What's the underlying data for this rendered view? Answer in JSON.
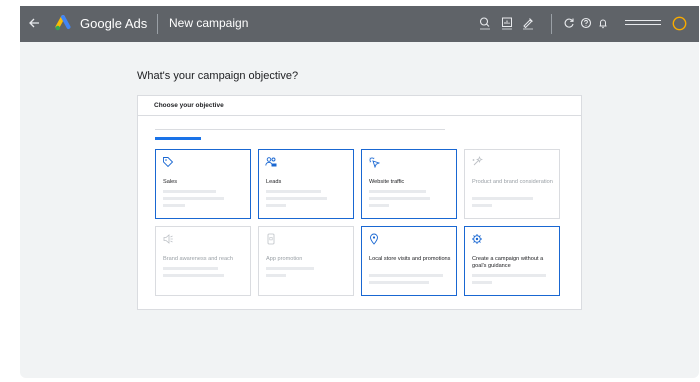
{
  "topbar": {
    "brand": "Google Ads",
    "page_title": "New campaign"
  },
  "question": "What's your campaign objective?",
  "panel": {
    "title": "Choose your objective",
    "progress": 0.16
  },
  "objectives": [
    {
      "label": "Sales",
      "icon": "tag-icon",
      "selected": true
    },
    {
      "label": "Leads",
      "icon": "people-icon",
      "selected": true
    },
    {
      "label": "Website traffic",
      "icon": "cursor-click-icon",
      "selected": true
    },
    {
      "label": "Product and brand consideration",
      "icon": "sparkle-icon",
      "selected": false
    },
    {
      "label": "Brand awareness and reach",
      "icon": "speaker-icon",
      "selected": false
    },
    {
      "label": "App promotion",
      "icon": "phone-icon",
      "selected": false
    },
    {
      "label": "Local store visits and promotions",
      "icon": "location-pin-icon",
      "selected": true
    },
    {
      "label": "Create a campaign without a goal's guidance",
      "icon": "gear-icon",
      "selected": true
    }
  ],
  "colors": {
    "topbar": "#5f6368",
    "accent": "#1a73e8",
    "selected_border": "#1967d2",
    "avatar": "#f9ab00"
  }
}
